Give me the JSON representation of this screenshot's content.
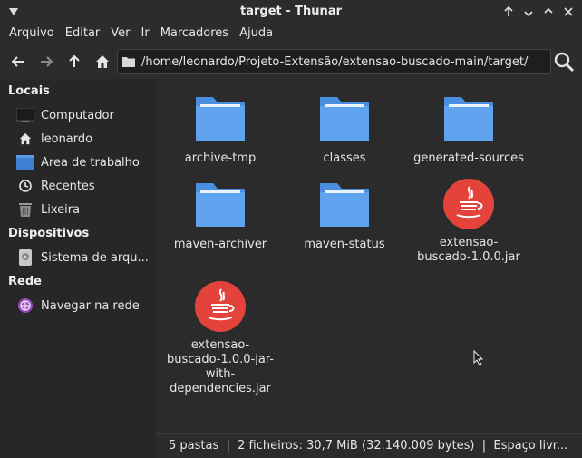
{
  "window": {
    "title": "target - Thunar"
  },
  "menubar": {
    "items": [
      "Arquivo",
      "Editar",
      "Ver",
      "Ir",
      "Marcadores",
      "Ajuda"
    ]
  },
  "toolbar": {
    "path": "/home/leonardo/Projeto-Extensão/extensao-buscado-main/target/"
  },
  "sidebar": {
    "sections": [
      {
        "heading": "Locais",
        "items": [
          {
            "label": "Computador",
            "icon": "computer-icon"
          },
          {
            "label": "leonardo",
            "icon": "home-icon"
          },
          {
            "label": "Área de trabalho",
            "icon": "desktop-icon"
          },
          {
            "label": "Recentes",
            "icon": "clock-icon"
          },
          {
            "label": "Lixeira",
            "icon": "trash-icon"
          }
        ]
      },
      {
        "heading": "Dispositivos",
        "items": [
          {
            "label": "Sistema de arqu...",
            "icon": "drive-icon"
          }
        ]
      },
      {
        "heading": "Rede",
        "items": [
          {
            "label": "Navegar na rede",
            "icon": "network-icon"
          }
        ]
      }
    ]
  },
  "files": [
    {
      "name": "archive-tmp",
      "type": "folder"
    },
    {
      "name": "classes",
      "type": "folder"
    },
    {
      "name": "generated-sources",
      "type": "folder"
    },
    {
      "name": "maven-archiver",
      "type": "folder"
    },
    {
      "name": "maven-status",
      "type": "folder"
    },
    {
      "name": "extensao-\nbuscado-1.0.0.jar",
      "type": "jar"
    },
    {
      "name": "extensao-\nbuscado-1.0.0-jar-\nwith-\ndependencies.jar",
      "type": "jar"
    }
  ],
  "status": {
    "text": "5 pastas  |  2 ficheiros: 30,7 MiB (32.140.009 bytes)  |  Espaço livr..."
  },
  "colors": {
    "folder": "#4a8fdf",
    "folder_light": "#5fa3ee",
    "jar": "#e3433a",
    "background": "#2b2b2b",
    "sidebar": "#272727"
  }
}
